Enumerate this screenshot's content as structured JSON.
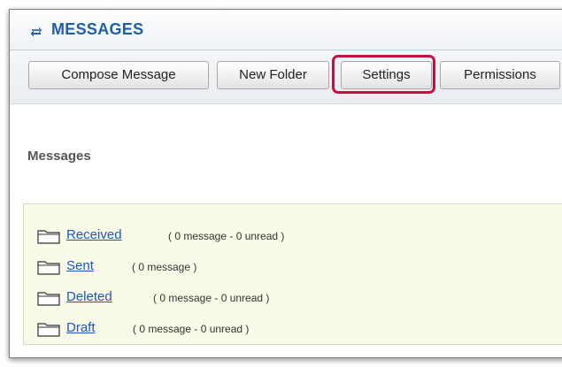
{
  "header": {
    "title": "MESSAGES",
    "icon": "sync-arrows-icon"
  },
  "toolbar": {
    "compose_label": "Compose Message",
    "new_folder_label": "New Folder",
    "settings_label": "Settings",
    "permissions_label": "Permissions"
  },
  "section": {
    "title": "Messages"
  },
  "folders": [
    {
      "name": "Received",
      "info": "( 0 message - 0 unread )"
    },
    {
      "name": "Sent",
      "info": "( 0 message )"
    },
    {
      "name": "Deleted",
      "info": "( 0 message - 0 unread )"
    },
    {
      "name": "Draft",
      "info": "( 0 message - 0 unread )"
    }
  ],
  "colors": {
    "title_blue": "#1f5fa8",
    "link_blue": "#1a56c4",
    "highlight_red": "#c8103e",
    "folder_panel_bg": "#fafae8"
  }
}
